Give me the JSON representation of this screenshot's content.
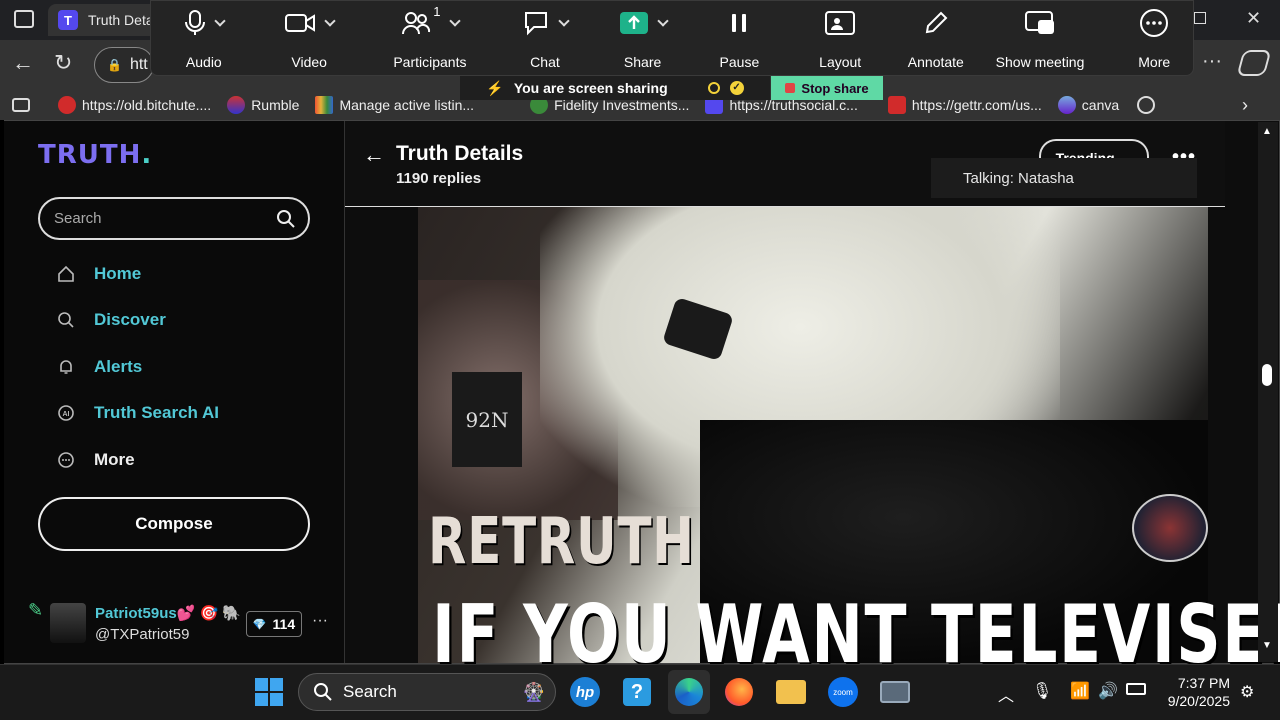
{
  "browser": {
    "tab_title": "Truth Deta",
    "tab_favicon": "T",
    "address_text": "htt",
    "bookmarks": [
      {
        "label": "https://old.bitchute....",
        "icon": "bitchute-icon",
        "color": "#d12b2b"
      },
      {
        "label": "Rumble",
        "icon": "rumble-icon",
        "color": "#3a7bd5"
      },
      {
        "label": "Manage active listin...",
        "icon": "ebay-icon",
        "color": "#e5b13a"
      },
      {
        "label": "Fidelity Investments...",
        "icon": "fidelity-icon",
        "color": "#3a8a3a"
      },
      {
        "label": "https://truthsocial.c...",
        "icon": "truth-icon",
        "color": "#5448ee"
      },
      {
        "label": "https://gettr.com/us...",
        "icon": "gettr-icon",
        "color": "#d12b2b"
      },
      {
        "label": "canva",
        "icon": "canva-icon",
        "color": "#2b8bd5"
      }
    ]
  },
  "zoom": {
    "buttons": [
      {
        "label": "Audio",
        "icon": "microphone-icon"
      },
      {
        "label": "Video",
        "icon": "video-camera-icon"
      },
      {
        "label": "Participants",
        "icon": "participants-icon",
        "count": "1"
      },
      {
        "label": "Chat",
        "icon": "chat-icon"
      },
      {
        "label": "Share",
        "icon": "share-screen-icon"
      },
      {
        "label": "Pause",
        "icon": "pause-icon"
      },
      {
        "label": "Layout",
        "icon": "layout-icon"
      },
      {
        "label": "Annotate",
        "icon": "pencil-icon"
      },
      {
        "label": "Show meeting",
        "icon": "show-meeting-icon"
      },
      {
        "label": "More",
        "icon": "more-icon"
      }
    ],
    "share_banner": "You are screen sharing",
    "stop_share": "Stop share",
    "talking": "Talking: Natasha",
    "accent": "#0e72ed"
  },
  "sidebar": {
    "logo": "TRUTH",
    "logo_dot": ".",
    "search_placeholder": "Search",
    "nav": [
      {
        "label": "Home",
        "icon": "home-icon"
      },
      {
        "label": "Discover",
        "icon": "search-icon"
      },
      {
        "label": "Alerts",
        "icon": "bell-icon"
      },
      {
        "label": "Truth Search AI",
        "icon": "ai-icon"
      },
      {
        "label": "More",
        "icon": "more-circle-icon"
      }
    ],
    "compose": "Compose",
    "profile": {
      "name": "Patriot59us💕 🎯 🐘",
      "handle": "@TXPatriot59",
      "badge_count": "114"
    }
  },
  "post": {
    "title": "Truth Details",
    "replies": "1190 replies",
    "sort": "Trending",
    "video_caption_1": "RETRUTH",
    "video_caption_2": "IF YOU WANT TELEVISED",
    "mic_label": "92N"
  },
  "taskbar": {
    "search": "Search",
    "time": "7:37 PM",
    "date": "9/20/2025"
  }
}
